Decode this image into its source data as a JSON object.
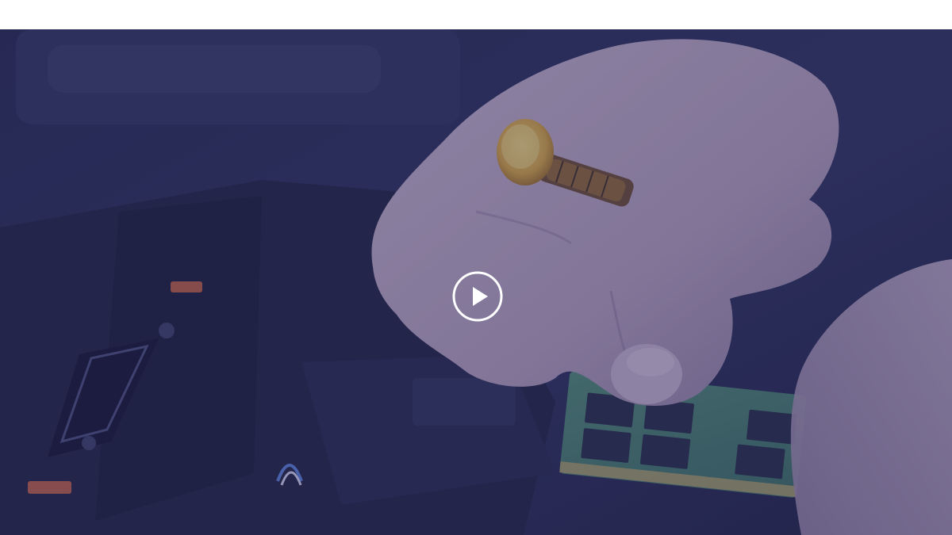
{
  "video": {
    "play_icon": "play-circle-icon",
    "overlay_color": "#30326e",
    "poster_subject": "hands-installing-ram-module-illustration"
  }
}
